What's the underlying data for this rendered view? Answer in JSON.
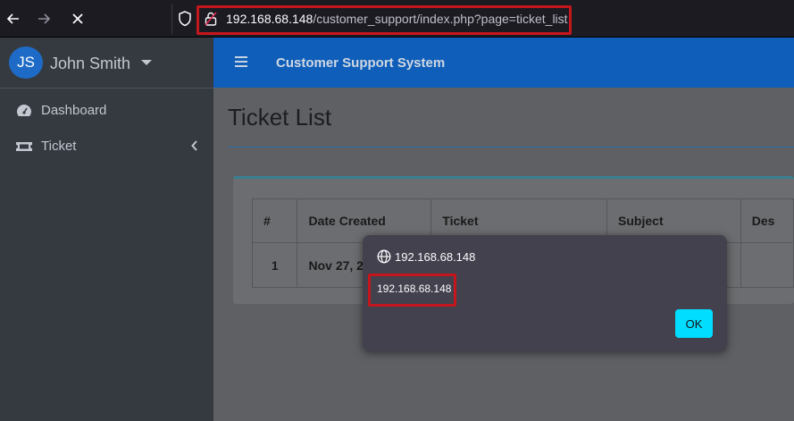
{
  "browser": {
    "url_host": "192.168.68.148",
    "url_path": "/customer_support/index.php?page=ticket_list"
  },
  "sidebar": {
    "avatar_initials": "JS",
    "user_name": "John Smith",
    "items": [
      {
        "label": "Dashboard",
        "icon": "dashboard-icon"
      },
      {
        "label": "Ticket",
        "icon": "ticket-icon"
      }
    ]
  },
  "header": {
    "brand": "Customer Support System"
  },
  "main": {
    "page_title": "Ticket List",
    "table": {
      "columns": [
        "#",
        "Date Created",
        "Ticket",
        "Subject",
        "Des"
      ],
      "rows": [
        [
          "1",
          "Nov 27, 2",
          "",
          "",
          ""
        ]
      ]
    }
  },
  "dialog": {
    "title": "192.168.68.148",
    "message": "192.168.68.148",
    "ok_label": "OK"
  },
  "colors": {
    "brand_blue": "#0f5eb9",
    "sidebar_bg": "#343a40",
    "ok_button": "#00ddff",
    "highlight_red": "#c4161c"
  }
}
